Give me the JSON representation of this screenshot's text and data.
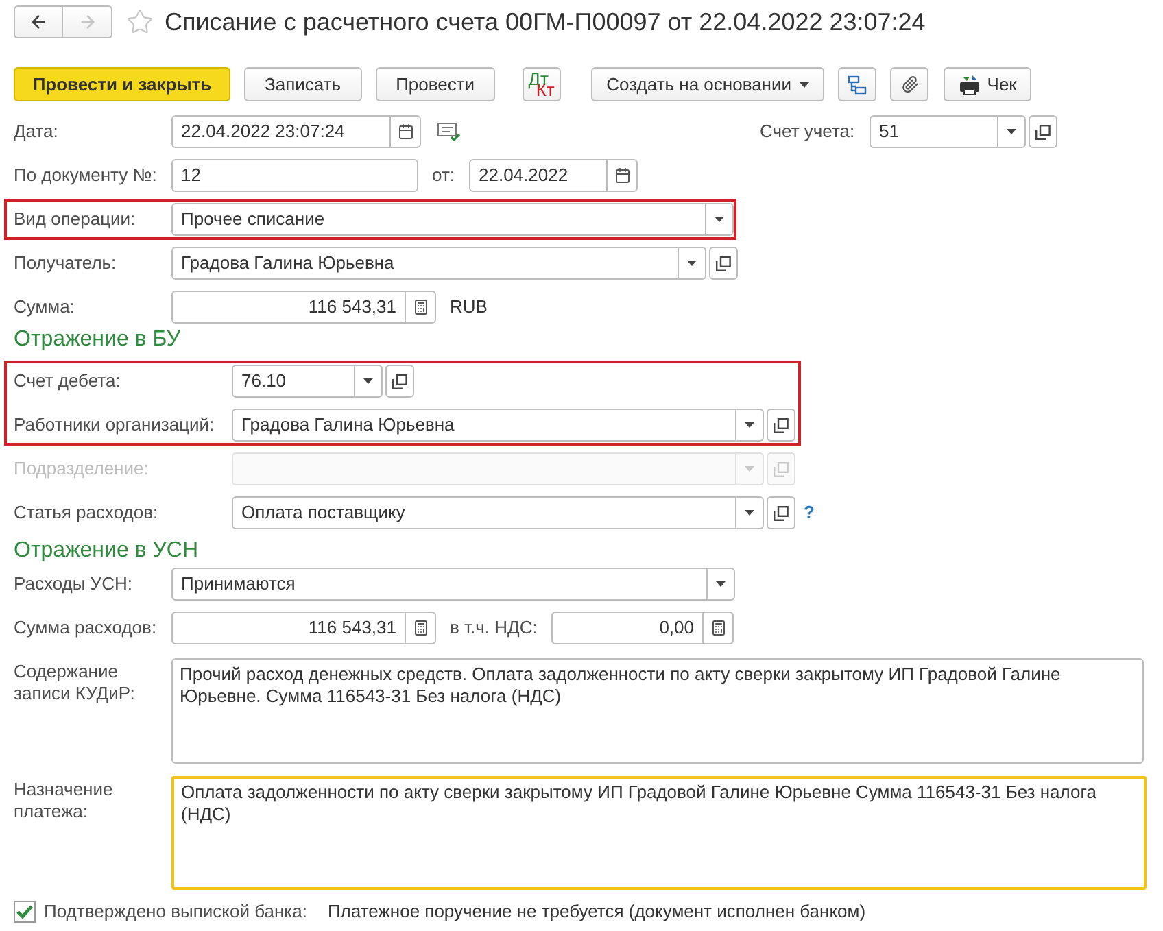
{
  "window": {
    "title": "Списание с расчетного счета 00ГМ-П00097 от 22.04.2022 23:07:24"
  },
  "nav": [
    {
      "kind": "back",
      "disabled": false
    },
    {
      "kind": "forward",
      "disabled": true
    }
  ],
  "toolbar": [
    {
      "kind": "primary",
      "label": "Провести и закрыть"
    },
    {
      "kind": "button",
      "label": "Записать"
    },
    {
      "kind": "button",
      "label": "Провести"
    },
    {
      "kind": "dtkt",
      "label_top": "Дт",
      "label_bottom": "Кт"
    },
    {
      "kind": "menu",
      "label": "Создать на основании"
    },
    {
      "kind": "structure"
    },
    {
      "kind": "attach"
    },
    {
      "kind": "receipt",
      "label": "Чек"
    }
  ],
  "date": {
    "label": "Дата:",
    "value": "22.04.2022 23:07:24"
  },
  "account": {
    "label": "Счет учета:",
    "value": "51"
  },
  "doc_number": {
    "label": "По документу №:",
    "value": "12"
  },
  "doc_date": {
    "label": "от:",
    "value": "22.04.2022"
  },
  "operation": {
    "label": "Вид операции:",
    "value": "Прочее списание",
    "highlighted": true
  },
  "recipient": {
    "label": "Получатель:",
    "value": "Градова Галина Юрьевна"
  },
  "amount": {
    "label": "Сумма:",
    "value": "116 543,31",
    "currency": "RUB"
  },
  "bu": {
    "title": "Отражение в БУ",
    "highlighted": true,
    "debit": {
      "label": "Счет дебета:",
      "value": "76.10"
    },
    "employees": {
      "label": "Работники организаций:",
      "value": "Градова Галина Юрьевна"
    },
    "department": {
      "label": "Подразделение:",
      "disabled": true
    },
    "expense_item": {
      "label": "Статья расходов:",
      "value": "Оплата поставщику",
      "help": "?"
    }
  },
  "usn": {
    "title": "Отражение в УСН",
    "expenses": {
      "label": "Расходы УСН:",
      "value": "Принимаются"
    },
    "expense_amount": {
      "label": "Сумма расходов:",
      "value": "116 543,31"
    },
    "vat": {
      "label": "в т.ч. НДС:",
      "value": "0,00"
    }
  },
  "kudir": {
    "label": "Содержание записи КУДиР:",
    "value": "Прочий расход денежных средств. Оплата задолженности по акту сверки закрытому ИП Градовой Галине Юрьевне. Сумма 116543-31 Без налога (НДС)"
  },
  "purpose": {
    "label": "Назначение платежа:",
    "value": "Оплата задолженности по акту сверки закрытому ИП Градовой Галине Юрьевне Сумма 116543-31 Без налога (НДС)",
    "focused": true
  },
  "bank_confirmed": {
    "label": "Подтверждено выпиской банка:",
    "checked": true
  },
  "payment_note": "Платежное поручение не требуется (документ исполнен банком)"
}
